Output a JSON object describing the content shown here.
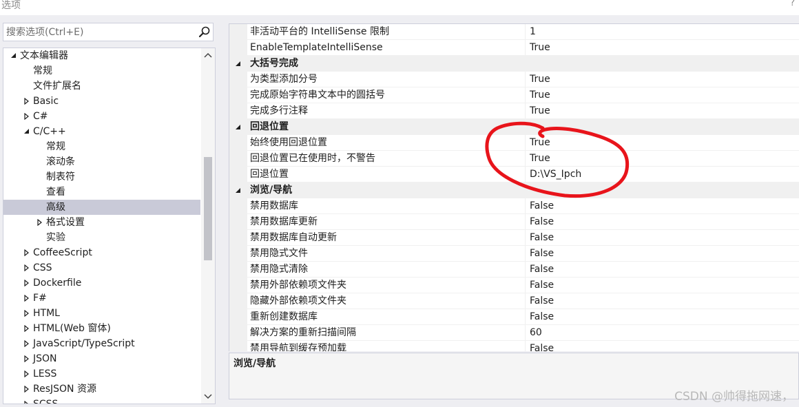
{
  "window": {
    "title": "选项",
    "help_glyph": "?"
  },
  "search": {
    "placeholder": "搜索选项(Ctrl+E)",
    "value": ""
  },
  "tree": {
    "items": [
      {
        "label": "文本编辑器",
        "level": 0,
        "arrow": "expanded"
      },
      {
        "label": "常规",
        "level": 1,
        "arrow": "none"
      },
      {
        "label": "文件扩展名",
        "level": 1,
        "arrow": "none"
      },
      {
        "label": "Basic",
        "level": 1,
        "arrow": "collapsed"
      },
      {
        "label": "C#",
        "level": 1,
        "arrow": "collapsed"
      },
      {
        "label": "C/C++",
        "level": 1,
        "arrow": "expanded"
      },
      {
        "label": "常规",
        "level": 2,
        "arrow": "none"
      },
      {
        "label": "滚动条",
        "level": 2,
        "arrow": "none"
      },
      {
        "label": "制表符",
        "level": 2,
        "arrow": "none"
      },
      {
        "label": "查看",
        "level": 2,
        "arrow": "none"
      },
      {
        "label": "高级",
        "level": 2,
        "arrow": "none",
        "selected": true
      },
      {
        "label": "格式设置",
        "level": 2,
        "arrow": "collapsed"
      },
      {
        "label": "实验",
        "level": 2,
        "arrow": "none"
      },
      {
        "label": "CoffeeScript",
        "level": 1,
        "arrow": "collapsed"
      },
      {
        "label": "CSS",
        "level": 1,
        "arrow": "collapsed"
      },
      {
        "label": "Dockerfile",
        "level": 1,
        "arrow": "collapsed"
      },
      {
        "label": "F#",
        "level": 1,
        "arrow": "collapsed"
      },
      {
        "label": "HTML",
        "level": 1,
        "arrow": "collapsed"
      },
      {
        "label": "HTML(Web 窗体)",
        "level": 1,
        "arrow": "collapsed"
      },
      {
        "label": "JavaScript/TypeScript",
        "level": 1,
        "arrow": "collapsed"
      },
      {
        "label": "JSON",
        "level": 1,
        "arrow": "collapsed"
      },
      {
        "label": "LESS",
        "level": 1,
        "arrow": "collapsed"
      },
      {
        "label": "ResJSON 资源",
        "level": 1,
        "arrow": "collapsed"
      },
      {
        "label": "SCSS",
        "level": 1,
        "arrow": "collapsed"
      }
    ]
  },
  "grid": {
    "rows": [
      {
        "type": "prop",
        "name": "非活动平台的 IntelliSense 限制",
        "value": "1"
      },
      {
        "type": "prop",
        "name": "EnableTemplateIntelliSense",
        "value": "True"
      },
      {
        "type": "category",
        "name": "大括号完成"
      },
      {
        "type": "prop",
        "name": "为类型添加分号",
        "value": "True"
      },
      {
        "type": "prop",
        "name": "完成原始字符串文本中的圆括号",
        "value": "True"
      },
      {
        "type": "prop",
        "name": "完成多行注释",
        "value": "True"
      },
      {
        "type": "category",
        "name": "回退位置"
      },
      {
        "type": "prop",
        "name": "始终使用回退位置",
        "value": "True"
      },
      {
        "type": "prop",
        "name": "回退位置已在使用时，不警告",
        "value": "True"
      },
      {
        "type": "prop",
        "name": "回退位置",
        "value": "D:\\VS_Ipch"
      },
      {
        "type": "category",
        "name": "浏览/导航"
      },
      {
        "type": "prop",
        "name": "禁用数据库",
        "value": "False"
      },
      {
        "type": "prop",
        "name": "禁用数据库更新",
        "value": "False"
      },
      {
        "type": "prop",
        "name": "禁用数据库自动更新",
        "value": "False"
      },
      {
        "type": "prop",
        "name": "禁用隐式文件",
        "value": "False"
      },
      {
        "type": "prop",
        "name": "禁用隐式清除",
        "value": "False"
      },
      {
        "type": "prop",
        "name": "禁用外部依赖项文件夹",
        "value": "False"
      },
      {
        "type": "prop",
        "name": "隐藏外部依赖项文件夹",
        "value": "False"
      },
      {
        "type": "prop",
        "name": "重新创建数据库",
        "value": "False"
      },
      {
        "type": "prop",
        "name": "解决方案的重新扫描间隔",
        "value": "60"
      },
      {
        "type": "prop",
        "name": "禁用导航到缓存预加载",
        "value": "False"
      }
    ]
  },
  "description": {
    "title": "浏览/导航"
  },
  "watermark": "CSDN @帅得拖网速，",
  "colors": {
    "selection": "#c9cad8",
    "annotation": "#e8141b",
    "border": "#cccedb"
  }
}
